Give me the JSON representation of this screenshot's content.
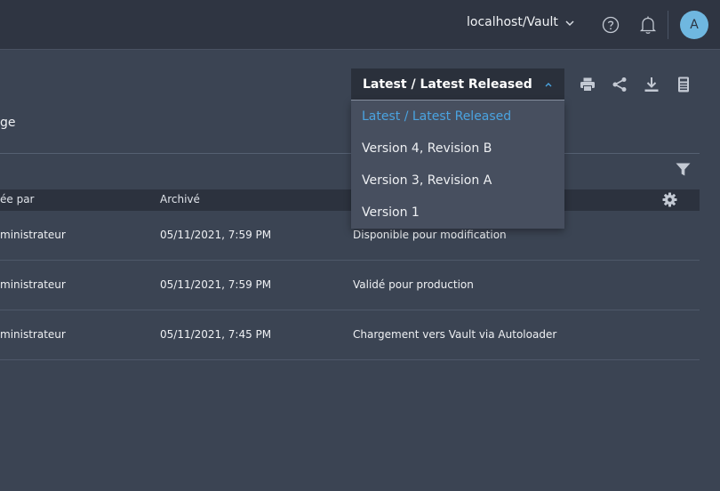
{
  "header": {
    "server_label": "localhost/Vault",
    "avatar_initial": "A"
  },
  "toolbar": {
    "version_selected": "Latest / Latest Released",
    "version_options": [
      "Latest / Latest Released",
      "Version 4, Revision B",
      "Version 3, Revision A",
      "Version 1"
    ],
    "icons": [
      "print-icon",
      "share-icon",
      "download-icon",
      "calculator-icon"
    ]
  },
  "tab": {
    "label": "ge"
  },
  "table": {
    "columns": [
      "ée par",
      "Archivé",
      ""
    ],
    "rows": [
      [
        "ministrateur",
        "05/11/2021, 7:59 PM",
        "Disponible pour modification"
      ],
      [
        "ministrateur",
        "05/11/2021, 7:59 PM",
        "Validé pour production"
      ],
      [
        "ministrateur",
        "05/11/2021, 7:45 PM",
        "Chargement vers Vault via Autoloader"
      ]
    ]
  },
  "colors": {
    "background": "#3b4453",
    "topbar": "#2f3542",
    "accent": "#4aa3e0",
    "avatar": "#6fb7e0"
  }
}
